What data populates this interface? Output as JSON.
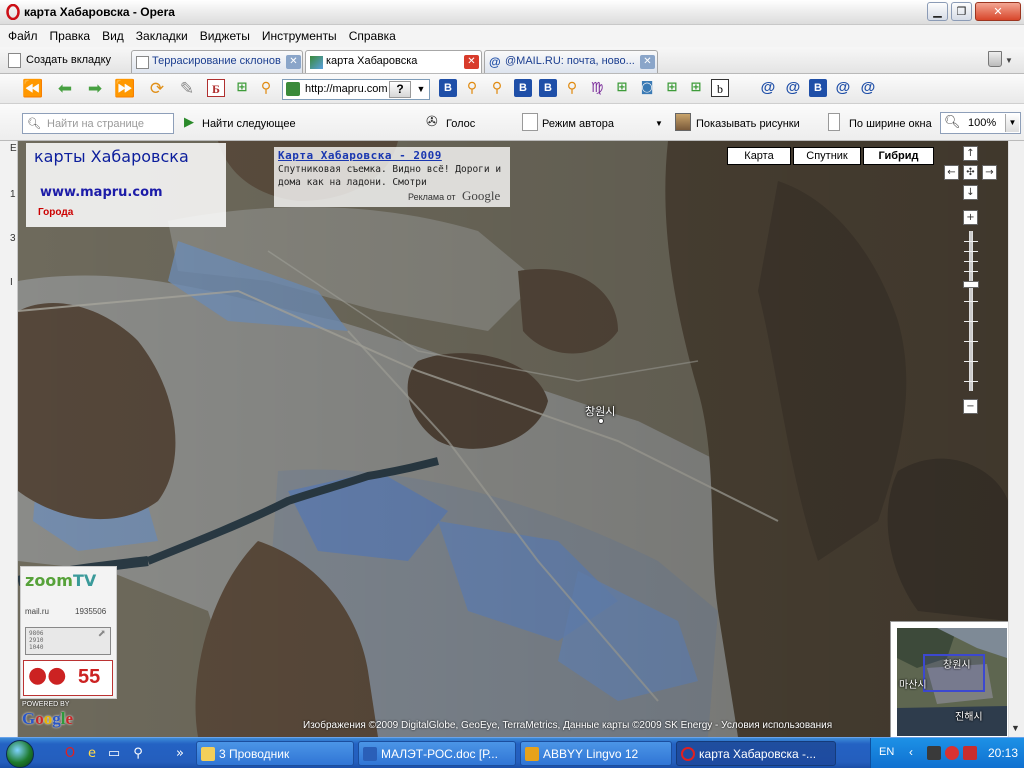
{
  "window": {
    "title": "карта Хабаровска - Opera"
  },
  "menu": [
    "Файл",
    "Правка",
    "Вид",
    "Закладки",
    "Виджеты",
    "Инструменты",
    "Справка"
  ],
  "tabs": {
    "new_tab_label": "Создать вкладку",
    "items": [
      {
        "label": "Террасирование склонов",
        "active": false
      },
      {
        "label": "карта Хабаровска",
        "active": true
      },
      {
        "label": "@MAIL.RU: почта, ново...",
        "active": false
      }
    ]
  },
  "address": {
    "url": "http://mapru.com"
  },
  "bookmark_icons": [
    "Б",
    "В",
    "В",
    "В",
    "В",
    "b",
    "В"
  ],
  "toolbar": {
    "find_placeholder": "Найти на странице",
    "find_next": "Найти следующее",
    "voice": "Голос",
    "author_mode": "Режим автора",
    "show_images": "Показывать рисунки",
    "fit_width": "По ширине окна",
    "zoom": "100%"
  },
  "side_strip": [
    "Е",
    "1",
    "3",
    "I"
  ],
  "map": {
    "brand_title": "карты Хабаровска",
    "brand_url": "www.mapru.com",
    "brand_cities": "Города",
    "ad": {
      "title": "Карта Хабаровска - 2009",
      "text": "Спутниковая съемка. Видно всё! Дороги и дома как на ладони. Смотри",
      "ads_by": "Реклама от",
      "google": "Google"
    },
    "map_types": [
      "Карта",
      "Спутник",
      "Гибрид"
    ],
    "active_map_type": "Гибрид",
    "controls": {
      "pan_up": "↑",
      "pan_left": "←",
      "pan_center": "✣",
      "pan_right": "→",
      "pan_down": "↓",
      "zoom_in": "+",
      "zoom_out": "−"
    },
    "city_label": "창원시",
    "overview_labels": [
      "창원시",
      "마산시",
      "진해시"
    ],
    "copyright": "Изображения ©2009 DigitalGlobe, GeoEye, TerraMetrics, Данные карты ©2009 SK Energy - Условия использования",
    "zoomtv": {
      "logo_a": "zoom",
      "logo_b": "TV",
      "mail": "mail.ru",
      "count": "1935506",
      "counter_lines": [
        "9806",
        "2910",
        "1040"
      ],
      "rating": "55"
    },
    "powered_by": "POWERED BY",
    "google_logo": "Google"
  },
  "taskbar": {
    "tasks": [
      {
        "label": "3 Проводник",
        "active": false
      },
      {
        "label": "МАЛЭТ-РОС.doc [Р...",
        "active": false
      },
      {
        "label": "ABBYY Lingvo 12",
        "active": false
      },
      {
        "label": "карта Хабаровска -...",
        "active": true
      }
    ],
    "language": "EN",
    "clock": "20:13"
  }
}
